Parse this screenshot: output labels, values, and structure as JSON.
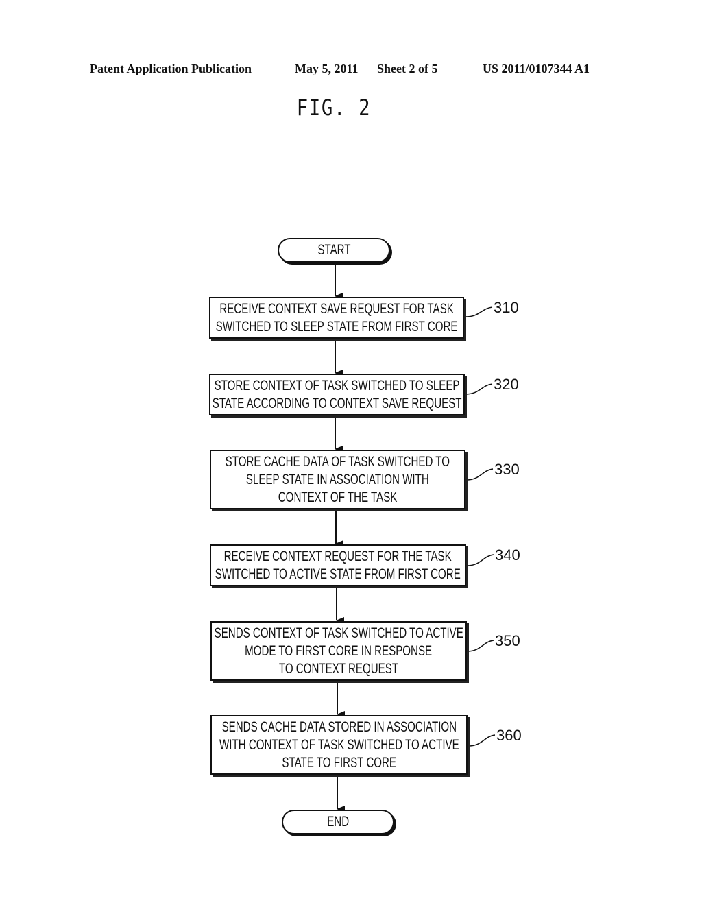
{
  "header": {
    "publication_type": "Patent Application Publication",
    "date": "May 5, 2011",
    "sheet": "Sheet 2 of 5",
    "publication_number": "US 2011/0107344 A1"
  },
  "figure": {
    "title": "FIG. 2"
  },
  "flowchart": {
    "start_label": "START",
    "end_label": "END",
    "steps": [
      {
        "ref": "310",
        "lines": [
          "RECEIVE CONTEXT SAVE REQUEST FOR TASK",
          "SWITCHED TO SLEEP STATE FROM FIRST CORE"
        ]
      },
      {
        "ref": "320",
        "lines": [
          "STORE CONTEXT OF TASK SWITCHED TO SLEEP",
          "STATE ACCORDING TO CONTEXT SAVE REQUEST"
        ]
      },
      {
        "ref": "330",
        "lines": [
          "STORE CACHE DATA OF TASK SWITCHED TO",
          "SLEEP STATE IN ASSOCIATION WITH",
          "CONTEXT OF THE TASK"
        ]
      },
      {
        "ref": "340",
        "lines": [
          "RECEIVE CONTEXT REQUEST FOR THE TASK",
          "SWITCHED TO ACTIVE STATE FROM FIRST CORE"
        ]
      },
      {
        "ref": "350",
        "lines": [
          "SENDS CONTEXT OF TASK SWITCHED TO ACTIVE",
          "MODE TO FIRST CORE IN RESPONSE",
          "TO CONTEXT REQUEST"
        ]
      },
      {
        "ref": "360",
        "lines": [
          "SENDS CACHE DATA STORED IN ASSOCIATION",
          "WITH CONTEXT OF TASK SWITCHED TO ACTIVE",
          "STATE TO FIRST CORE"
        ]
      }
    ]
  }
}
